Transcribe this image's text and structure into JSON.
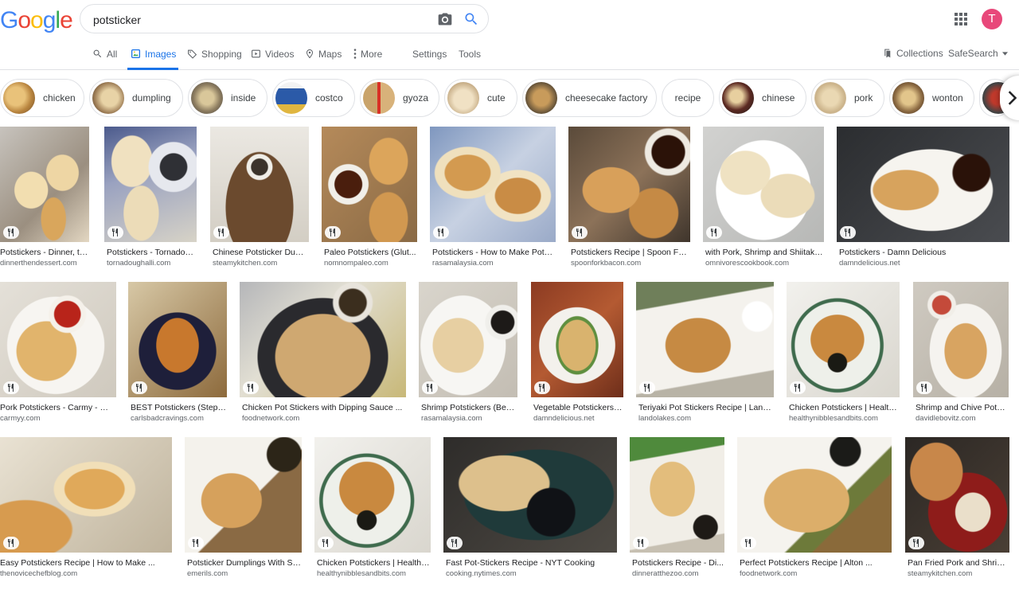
{
  "search": {
    "query": "potsticker"
  },
  "account": {
    "initial": "T",
    "color": "#e8487a"
  },
  "nav": {
    "all": "All",
    "images": "Images",
    "shopping": "Shopping",
    "videos": "Videos",
    "maps": "Maps",
    "more": "More",
    "settings": "Settings",
    "tools": "Tools",
    "collections": "Collections",
    "safesearch": "SafeSearch"
  },
  "chips": [
    {
      "label": "chicken"
    },
    {
      "label": "dumpling"
    },
    {
      "label": "inside"
    },
    {
      "label": "costco"
    },
    {
      "label": "gyoza"
    },
    {
      "label": "cute"
    },
    {
      "label": "cheesecake factory"
    },
    {
      "label": "recipe"
    },
    {
      "label": "chinese"
    },
    {
      "label": "pork"
    },
    {
      "label": "wonton"
    }
  ],
  "results": [
    {
      "title": "Potstickers - Dinner, th...",
      "domain": "dinnerthendessert.com"
    },
    {
      "title": "Potstickers - Tornadou...",
      "domain": "tornadoughalli.com"
    },
    {
      "title": "Chinese Potsticker Dum...",
      "domain": "steamykitchen.com"
    },
    {
      "title": "Paleo Potstickers (Glut...",
      "domain": "nomnompaleo.com"
    },
    {
      "title": "Potstickers - How to Make Potst...",
      "domain": "rasamalaysia.com"
    },
    {
      "title": "Potstickers Recipe | Spoon For...",
      "domain": "spoonforkbacon.com"
    },
    {
      "title": "with Pork, Shrimp and Shiitake ...",
      "domain": "omnivorescookbook.com"
    },
    {
      "title": "Potstickers - Damn Delicious",
      "domain": "damndelicious.net"
    },
    {
      "title": "Pork Potstickers - Carmy - Ru...",
      "domain": "carmyy.com"
    },
    {
      "title": "BEST Potstickers (Step-b...",
      "domain": "carlsbadcravings.com"
    },
    {
      "title": "Chicken Pot Stickers with Dipping Sauce ...",
      "domain": "foodnetwork.com"
    },
    {
      "title": "Shrimp Potstickers (Best...",
      "domain": "rasamalaysia.com"
    },
    {
      "title": "Vegetable Potstickers -...",
      "domain": "damndelicious.net"
    },
    {
      "title": "Teriyaki Pot Stickers Recipe | Land ...",
      "domain": "landolakes.com"
    },
    {
      "title": "Chicken Potstickers | Health...",
      "domain": "healthynibblesandbits.com"
    },
    {
      "title": "Shrimp and Chive Potsti...",
      "domain": "davidlebovitz.com"
    },
    {
      "title": "Easy Potstickers Recipe | How to Make ...",
      "domain": "thenovicechefblog.com"
    },
    {
      "title": "Potsticker Dumplings With Sp...",
      "domain": "emerils.com"
    },
    {
      "title": "Chicken Potstickers | Healthy ...",
      "domain": "healthynibblesandbits.com"
    },
    {
      "title": "Fast Pot-Stickers Recipe - NYT Cooking",
      "domain": "cooking.nytimes.com"
    },
    {
      "title": "Potstickers Recipe - Di...",
      "domain": "dinneratthezoo.com"
    },
    {
      "title": "Perfect Potstickers Recipe | Alton ...",
      "domain": "foodnetwork.com"
    },
    {
      "title": "Pan Fried Pork and Shrimp...",
      "domain": "steamykitchen.com"
    }
  ]
}
